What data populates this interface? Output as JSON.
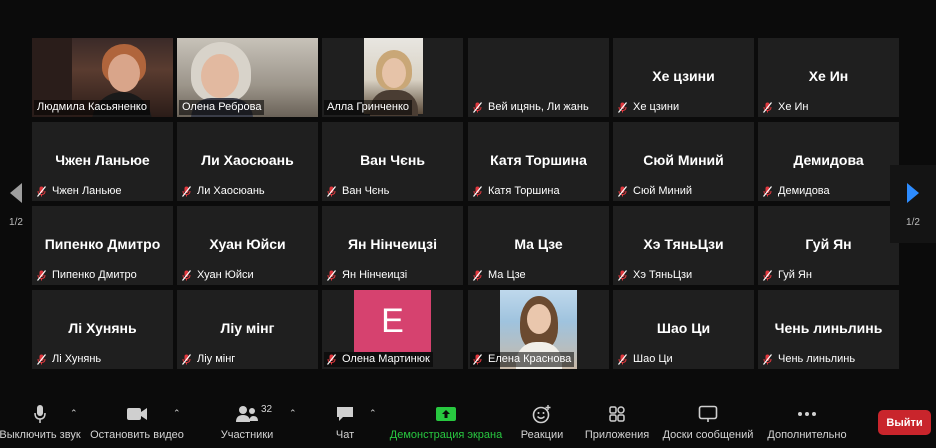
{
  "page": {
    "title": ""
  },
  "nav": {
    "page_left": "1/2",
    "page_right": "1/2"
  },
  "tiles": [
    {
      "name": "Людмила Касьяненко",
      "display": ""
    },
    {
      "name": "Олена Реброва",
      "display": ""
    },
    {
      "name": "Алла Гринченко",
      "display": ""
    },
    {
      "name": "Вей ицянь,  Ли жань",
      "display": ""
    },
    {
      "name": "Хе цзини",
      "display": "Хе цзини"
    },
    {
      "name": "Хе Ин",
      "display": "Хе Ин"
    },
    {
      "name": "Чжен Ланьюе",
      "display": "Чжен Ланьюе"
    },
    {
      "name": "Ли Хаосюань",
      "display": "Ли Хаосюань"
    },
    {
      "name": "Ван Чєнь",
      "display": "Ван Чєнь"
    },
    {
      "name": "Катя Торшина",
      "display": "Катя Торшина"
    },
    {
      "name": "Сюй Миний",
      "display": "Сюй Миний"
    },
    {
      "name": "Демидова",
      "display": "Демидова"
    },
    {
      "name": "Пипенко Дмитро",
      "display": "Пипенко Дмитро"
    },
    {
      "name": "Хуан Юйси",
      "display": "Хуан Юйси"
    },
    {
      "name": "Ян Нінчеицзі",
      "display": "Ян Нінчеицзі"
    },
    {
      "name": "Ма Цзе",
      "display": "Ма Цзе"
    },
    {
      "name": "Хэ ТяньЦзи",
      "display": "Хэ ТяньЦзи"
    },
    {
      "name": "Гуй Ян",
      "display": "Гуй Ян"
    },
    {
      "name": "Лі Хунянь",
      "display": "Лі Хунянь"
    },
    {
      "name": "Ліу мінг",
      "display": "Ліу мінг"
    },
    {
      "name": "Олена Мартинюк",
      "display": "",
      "avatar": "E"
    },
    {
      "name": "Елена Краснова",
      "display": ""
    },
    {
      "name": "Шао Ци",
      "display": "Шао Ци"
    },
    {
      "name": "Чень линьлинь",
      "display": "Чень линьлинь"
    }
  ],
  "toolbar": {
    "mute": "Выключить звук",
    "video": "Остановить видео",
    "participants": "Участники",
    "participants_count": "32",
    "chat": "Чат",
    "share": "Демонстрация экрана",
    "reactions": "Реакции",
    "apps": "Приложения",
    "whiteboard": "Доски сообщений",
    "more": "Дополнительно",
    "leave": "Выйти"
  },
  "colors": {
    "active_border": "#c7e25b",
    "share_green": "#28c840",
    "leave_red": "#c9252c",
    "muted_red": "#e0383e",
    "avatar_pink": "#d6426f"
  }
}
